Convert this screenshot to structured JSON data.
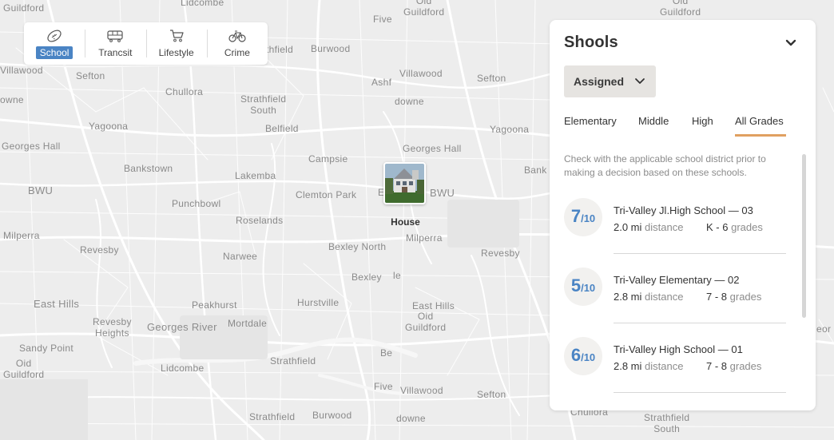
{
  "map": {
    "labels": [
      {
        "text": "Guildford"
      },
      {
        "text": "Lidcombe"
      },
      {
        "text": "Five"
      },
      {
        "text": "Oid\nGuildford"
      },
      {
        "text": "Oid\nGuildford"
      },
      {
        "text": "Villawood"
      },
      {
        "text": "Sefton"
      },
      {
        "text": "thfield"
      },
      {
        "text": "Burwood"
      },
      {
        "text": "Villawood"
      },
      {
        "text": "Sefton"
      },
      {
        "text": "Ashf"
      },
      {
        "text": "owne"
      },
      {
        "text": "Chullora"
      },
      {
        "text": "downe"
      },
      {
        "text": "Strathfield\nSouth"
      },
      {
        "text": "Yagoona"
      },
      {
        "text": "Belfield"
      },
      {
        "text": "Yagoona"
      },
      {
        "text": "Georges Hall"
      },
      {
        "text": "Georges Hall"
      },
      {
        "text": "Campsie"
      },
      {
        "text": "Bankstown"
      },
      {
        "text": "Lakemba"
      },
      {
        "text": "Bank"
      },
      {
        "text": "BWU"
      },
      {
        "text": "Clemton Park"
      },
      {
        "text": "E"
      },
      {
        "text": "BWU"
      },
      {
        "text": "Punchbowl"
      },
      {
        "text": "Roselands"
      },
      {
        "text": "Milperra"
      },
      {
        "text": "Milperra"
      },
      {
        "text": "Revesby"
      },
      {
        "text": "Narwee"
      },
      {
        "text": "Bexley North"
      },
      {
        "text": "Revesby"
      },
      {
        "text": "Bexley"
      },
      {
        "text": "le"
      },
      {
        "text": "East Hills"
      },
      {
        "text": "Peakhurst"
      },
      {
        "text": "Hurstville"
      },
      {
        "text": "East Hills"
      },
      {
        "text": "Oid\nGuildford"
      },
      {
        "text": "Revesby\nHeights"
      },
      {
        "text": "Georges River"
      },
      {
        "text": "Mortdale"
      },
      {
        "text": "Sandy Point"
      },
      {
        "text": "Oid\nGuildford"
      },
      {
        "text": "Be"
      },
      {
        "text": "Lidcombe"
      },
      {
        "text": "Strathfield"
      },
      {
        "text": "Five"
      },
      {
        "text": "Villawood"
      },
      {
        "text": "Sefton"
      },
      {
        "text": "Chullora"
      },
      {
        "text": "Strathfield"
      },
      {
        "text": "Burwood"
      },
      {
        "text": "downe"
      },
      {
        "text": "Strathfield\nSouth"
      },
      {
        "text": "eor"
      }
    ],
    "marker": {
      "label": "House"
    }
  },
  "toolbar": {
    "items": [
      {
        "label": "School",
        "icon": "football-icon",
        "active": true
      },
      {
        "label": "Trancsit",
        "icon": "tram-icon",
        "active": false
      },
      {
        "label": "Lifestyle",
        "icon": "cart-icon",
        "active": false
      },
      {
        "label": "Crime",
        "icon": "bicycle-icon",
        "active": false
      }
    ]
  },
  "panel": {
    "title": "Shools",
    "dropdown": {
      "value": "Assigned"
    },
    "tabs": [
      {
        "label": "Elementary",
        "active": false
      },
      {
        "label": "Middle",
        "active": false
      },
      {
        "label": "High",
        "active": false
      },
      {
        "label": "All Grades",
        "active": true
      }
    ],
    "disclaimer": "Check with the applicable school district prior to making a decision based on these schools.",
    "schools": [
      {
        "score": "7",
        "denom": "/10",
        "name": "Tri-Valley Jl.High School — 03",
        "distance": "2.0 mi",
        "distance_unit": "distance",
        "grades": "K - 6",
        "grades_unit": "grades"
      },
      {
        "score": "5",
        "denom": "/10",
        "name": "Tri-Valley Elementary — 02",
        "distance": "2.8 mi",
        "distance_unit": "distance",
        "grades": "7 - 8",
        "grades_unit": "grades"
      },
      {
        "score": "6",
        "denom": "/10",
        "name": "Tri-Valley High School — 01",
        "distance": "2.8 mi",
        "distance_unit": "distance",
        "grades": "7 - 8",
        "grades_unit": "grades"
      }
    ]
  },
  "colors": {
    "accent": "#4a84c4",
    "tab_underline": "#e0a061",
    "dropdown_bg": "#e6e4e1"
  }
}
